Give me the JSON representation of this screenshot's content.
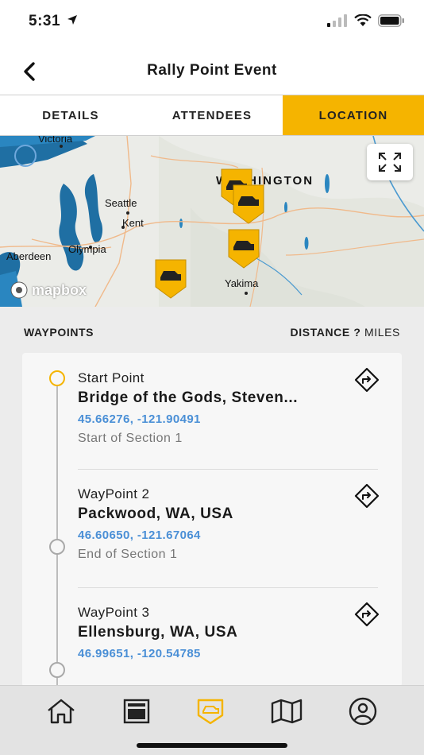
{
  "status": {
    "time": "5:31"
  },
  "header": {
    "title": "Rally Point Event"
  },
  "tabs": [
    {
      "label": "DETAILS"
    },
    {
      "label": "ATTENDEES"
    },
    {
      "label": "LOCATION"
    }
  ],
  "map": {
    "labels": {
      "victoria": "Victoria",
      "washington": "WASHINGTON",
      "seattle": "Seattle",
      "kent": "Kent",
      "olympia": "Olympia",
      "aberdeen": "Aberdeen",
      "yakima": "Yakima"
    },
    "attribution": "mapbox",
    "marker_color": "#f5b400"
  },
  "waypoints_header": {
    "title": "WAYPOINTS",
    "distance_label": "DISTANCE",
    "distance_value": "?",
    "distance_unit": "MILES"
  },
  "waypoints": [
    {
      "name": "Start Point",
      "place": "Bridge of the Gods, Steven...",
      "coords": "45.66276, -121.90491",
      "note": "Start of Section 1"
    },
    {
      "name": "WayPoint 2",
      "place": "Packwood, WA, USA",
      "coords": "46.60650, -121.67064",
      "note": "End of Section 1"
    },
    {
      "name": "WayPoint 3",
      "place": "Ellensburg, WA, USA",
      "coords": "46.99651, -120.54785",
      "note": ""
    }
  ],
  "bottom_nav": [
    {
      "icon": "home-icon"
    },
    {
      "icon": "news-icon"
    },
    {
      "icon": "rally-icon",
      "active": true
    },
    {
      "icon": "map-icon"
    },
    {
      "icon": "profile-icon"
    }
  ],
  "colors": {
    "accent": "#f5b400",
    "coords": "#4a8fd6",
    "water": "#1f6fa3"
  }
}
